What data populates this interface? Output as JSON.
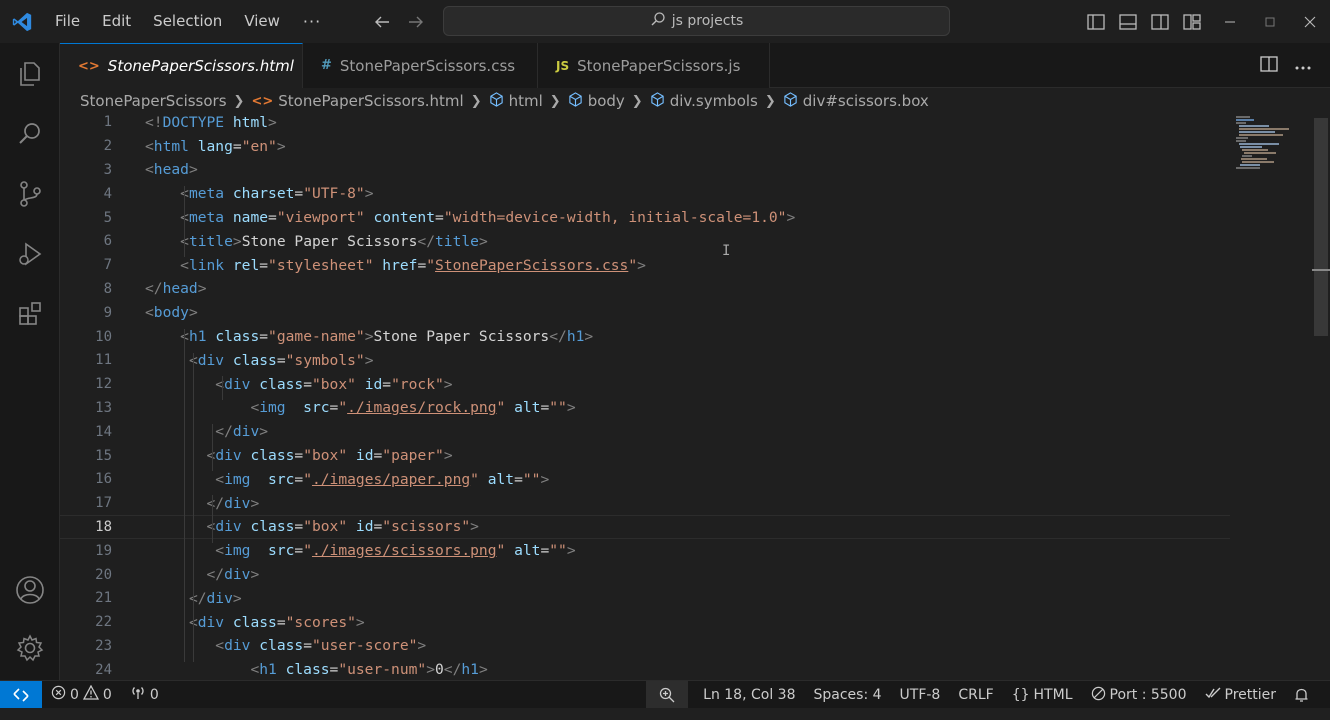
{
  "menu": {
    "file": "File",
    "edit": "Edit",
    "selection": "Selection",
    "view": "View",
    "more": "···"
  },
  "command_center": {
    "text": "js projects"
  },
  "tabs": [
    {
      "label": "StonePaperScissors.html",
      "icon": "<>",
      "active": true
    },
    {
      "label": "StonePaperScissors.css",
      "icon": "#",
      "active": false
    },
    {
      "label": "StonePaperScissors.js",
      "icon": "JS",
      "active": false
    }
  ],
  "breadcrumb": [
    "StonePaperScissors",
    "StonePaperScissors.html",
    "html",
    "body",
    "div.symbols",
    "div#scissors.box"
  ],
  "editor": {
    "line_numbers": [
      "1",
      "2",
      "3",
      "4",
      "5",
      "6",
      "7",
      "8",
      "9",
      "10",
      "11",
      "12",
      "13",
      "14",
      "15",
      "16",
      "17",
      "18",
      "19",
      "20",
      "21",
      "22",
      "23",
      "24"
    ],
    "current_line": 18,
    "lines": [
      [
        [
          "p",
          "<!"
        ],
        [
          "t",
          "DOCTYPE "
        ],
        [
          "a",
          "html"
        ],
        [
          "p",
          ">"
        ]
      ],
      [
        [
          "p",
          "<"
        ],
        [
          "t",
          "html "
        ],
        [
          "a",
          "lang"
        ],
        [
          "x",
          "="
        ],
        [
          "s",
          "\"en\""
        ],
        [
          "p",
          ">"
        ]
      ],
      [
        [
          "p",
          "<"
        ],
        [
          "t",
          "head"
        ],
        [
          "p",
          ">"
        ]
      ],
      [
        [
          "x",
          "    "
        ],
        [
          "p",
          "<"
        ],
        [
          "t",
          "meta "
        ],
        [
          "a",
          "charset"
        ],
        [
          "x",
          "="
        ],
        [
          "s",
          "\"UTF-8\""
        ],
        [
          "p",
          ">"
        ]
      ],
      [
        [
          "x",
          "    "
        ],
        [
          "p",
          "<"
        ],
        [
          "t",
          "meta "
        ],
        [
          "a",
          "name"
        ],
        [
          "x",
          "="
        ],
        [
          "s",
          "\"viewport\" "
        ],
        [
          "a",
          "content"
        ],
        [
          "x",
          "="
        ],
        [
          "s",
          "\"width=device-width, initial-scale=1.0\""
        ],
        [
          "p",
          ">"
        ]
      ],
      [
        [
          "x",
          "    "
        ],
        [
          "p",
          "<"
        ],
        [
          "t",
          "title"
        ],
        [
          "p",
          ">"
        ],
        [
          "x",
          "Stone Paper Scissors"
        ],
        [
          "p",
          "</"
        ],
        [
          "t",
          "title"
        ],
        [
          "p",
          ">"
        ]
      ],
      [
        [
          "x",
          "    "
        ],
        [
          "p",
          "<"
        ],
        [
          "t",
          "link "
        ],
        [
          "a",
          "rel"
        ],
        [
          "x",
          "="
        ],
        [
          "s",
          "\"stylesheet\" "
        ],
        [
          "a",
          "href"
        ],
        [
          "x",
          "="
        ],
        [
          "s",
          "\""
        ],
        [
          "u",
          "StonePaperScissors.css"
        ],
        [
          "s",
          "\""
        ],
        [
          "p",
          ">"
        ]
      ],
      [
        [
          "p",
          "</"
        ],
        [
          "t",
          "head"
        ],
        [
          "p",
          ">"
        ]
      ],
      [
        [
          "p",
          "<"
        ],
        [
          "t",
          "body"
        ],
        [
          "p",
          ">"
        ]
      ],
      [
        [
          "x",
          "    "
        ],
        [
          "p",
          "<"
        ],
        [
          "t",
          "h1 "
        ],
        [
          "a",
          "class"
        ],
        [
          "x",
          "="
        ],
        [
          "s",
          "\"game-name\""
        ],
        [
          "p",
          ">"
        ],
        [
          "x",
          "Stone Paper Scissors"
        ],
        [
          "p",
          "</"
        ],
        [
          "t",
          "h1"
        ],
        [
          "p",
          ">"
        ]
      ],
      [
        [
          "x",
          "     "
        ],
        [
          "p",
          "<"
        ],
        [
          "t",
          "div "
        ],
        [
          "a",
          "class"
        ],
        [
          "x",
          "="
        ],
        [
          "s",
          "\"symbols\""
        ],
        [
          "p",
          ">"
        ]
      ],
      [
        [
          "x",
          "        "
        ],
        [
          "p",
          "<"
        ],
        [
          "t",
          "div "
        ],
        [
          "a",
          "class"
        ],
        [
          "x",
          "="
        ],
        [
          "s",
          "\"box\" "
        ],
        [
          "a",
          "id"
        ],
        [
          "x",
          "="
        ],
        [
          "s",
          "\"rock\""
        ],
        [
          "p",
          ">"
        ]
      ],
      [
        [
          "x",
          "            "
        ],
        [
          "p",
          "<"
        ],
        [
          "t",
          "img  "
        ],
        [
          "a",
          "src"
        ],
        [
          "x",
          "="
        ],
        [
          "s",
          "\""
        ],
        [
          "u",
          "./images/rock.png"
        ],
        [
          "s",
          "\" "
        ],
        [
          "a",
          "alt"
        ],
        [
          "x",
          "="
        ],
        [
          "s",
          "\"\""
        ],
        [
          "p",
          ">"
        ]
      ],
      [
        [
          "x",
          "        "
        ],
        [
          "p",
          "</"
        ],
        [
          "t",
          "div"
        ],
        [
          "p",
          ">"
        ]
      ],
      [
        [
          "x",
          "       "
        ],
        [
          "p",
          "<"
        ],
        [
          "t",
          "div "
        ],
        [
          "a",
          "class"
        ],
        [
          "x",
          "="
        ],
        [
          "s",
          "\"box\" "
        ],
        [
          "a",
          "id"
        ],
        [
          "x",
          "="
        ],
        [
          "s",
          "\"paper\""
        ],
        [
          "p",
          ">"
        ]
      ],
      [
        [
          "x",
          "        "
        ],
        [
          "p",
          "<"
        ],
        [
          "t",
          "img  "
        ],
        [
          "a",
          "src"
        ],
        [
          "x",
          "="
        ],
        [
          "s",
          "\""
        ],
        [
          "u",
          "./images/paper.png"
        ],
        [
          "s",
          "\" "
        ],
        [
          "a",
          "alt"
        ],
        [
          "x",
          "="
        ],
        [
          "s",
          "\"\""
        ],
        [
          "p",
          ">"
        ]
      ],
      [
        [
          "x",
          "       "
        ],
        [
          "p",
          "</"
        ],
        [
          "t",
          "div"
        ],
        [
          "p",
          ">"
        ]
      ],
      [
        [
          "x",
          "       "
        ],
        [
          "p",
          "<"
        ],
        [
          "t",
          "div "
        ],
        [
          "a",
          "class"
        ],
        [
          "x",
          "="
        ],
        [
          "s",
          "\"box\" "
        ],
        [
          "a",
          "id"
        ],
        [
          "x",
          "="
        ],
        [
          "s",
          "\"scissors\""
        ],
        [
          "p",
          ">"
        ]
      ],
      [
        [
          "x",
          "        "
        ],
        [
          "p",
          "<"
        ],
        [
          "t",
          "img  "
        ],
        [
          "a",
          "src"
        ],
        [
          "x",
          "="
        ],
        [
          "s",
          "\""
        ],
        [
          "u",
          "./images/scissors.png"
        ],
        [
          "s",
          "\" "
        ],
        [
          "a",
          "alt"
        ],
        [
          "x",
          "="
        ],
        [
          "s",
          "\"\""
        ],
        [
          "p",
          ">"
        ]
      ],
      [
        [
          "x",
          "       "
        ],
        [
          "p",
          "</"
        ],
        [
          "t",
          "div"
        ],
        [
          "p",
          ">"
        ]
      ],
      [
        [
          "x",
          "     "
        ],
        [
          "p",
          "</"
        ],
        [
          "t",
          "div"
        ],
        [
          "p",
          ">"
        ]
      ],
      [
        [
          "x",
          "     "
        ],
        [
          "p",
          "<"
        ],
        [
          "t",
          "div "
        ],
        [
          "a",
          "class"
        ],
        [
          "x",
          "="
        ],
        [
          "s",
          "\"scores\""
        ],
        [
          "p",
          ">"
        ]
      ],
      [
        [
          "x",
          "        "
        ],
        [
          "p",
          "<"
        ],
        [
          "t",
          "div "
        ],
        [
          "a",
          "class"
        ],
        [
          "x",
          "="
        ],
        [
          "s",
          "\"user-score\""
        ],
        [
          "p",
          ">"
        ]
      ],
      [
        [
          "x",
          "            "
        ],
        [
          "p",
          "<"
        ],
        [
          "t",
          "h1 "
        ],
        [
          "a",
          "class"
        ],
        [
          "x",
          "="
        ],
        [
          "s",
          "\"user-num\""
        ],
        [
          "p",
          ">"
        ],
        [
          "x",
          "0"
        ],
        [
          "p",
          "</"
        ],
        [
          "t",
          "h1"
        ],
        [
          "p",
          ">"
        ]
      ]
    ]
  },
  "statusbar": {
    "errors": "0",
    "warnings": "0",
    "ports": "0",
    "position": "Ln 18, Col 38",
    "spaces": "Spaces: 4",
    "encoding": "UTF-8",
    "eol": "CRLF",
    "language": "HTML",
    "port": "Port : 5500",
    "formatter": "Prettier"
  },
  "colors": {
    "accent": "#0078d4",
    "tag": "#569cd6",
    "attr": "#9cdcfe",
    "string": "#ce9178"
  }
}
